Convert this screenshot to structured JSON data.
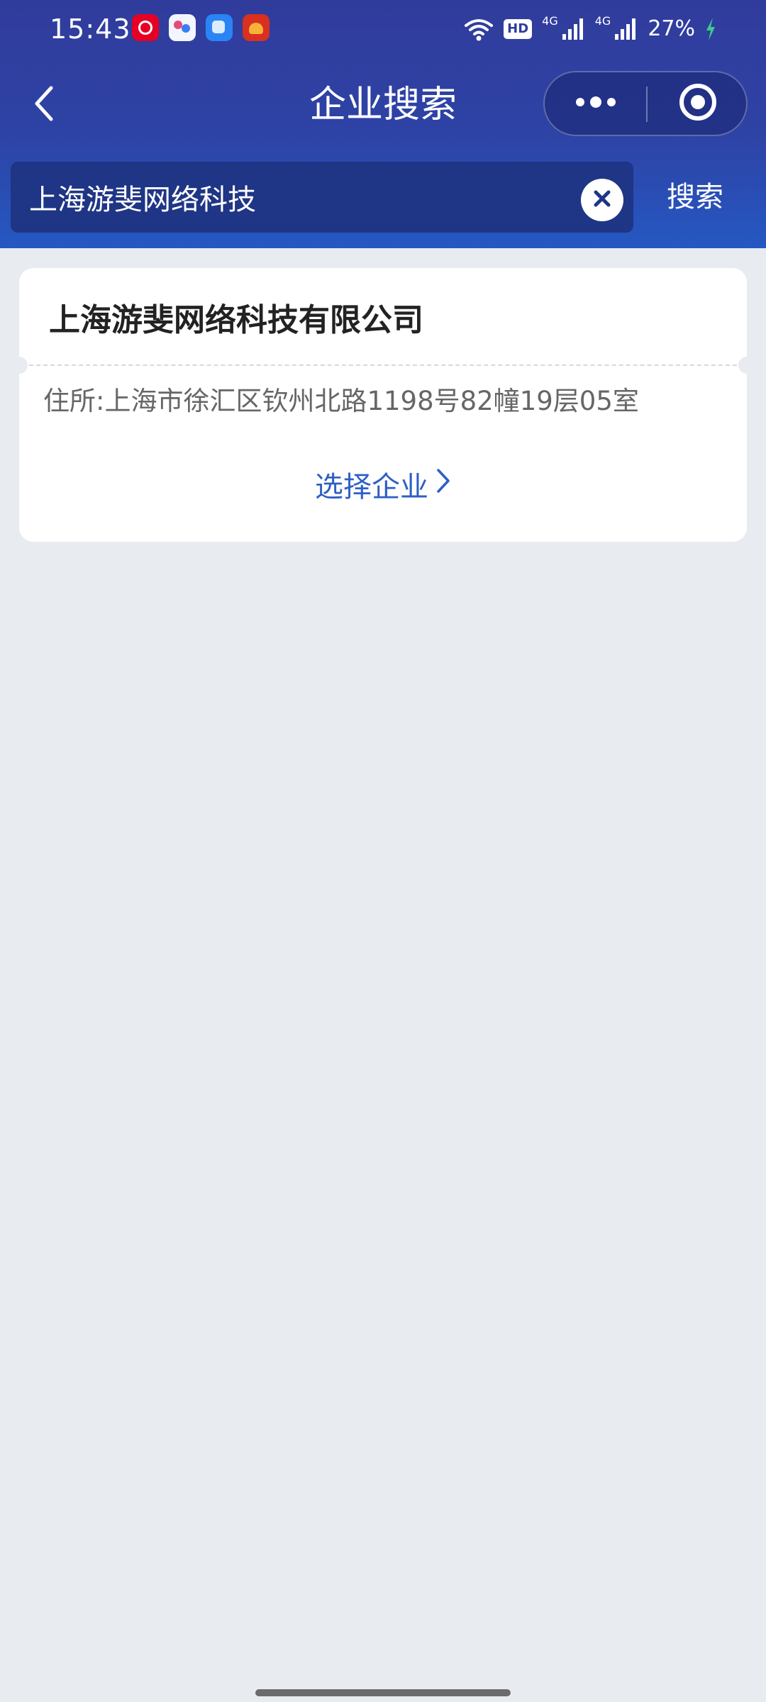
{
  "status_bar": {
    "time": "15:43",
    "hd_label": "HD",
    "network_1": "4G",
    "network_2": "4G",
    "battery": "27%"
  },
  "navbar": {
    "title": "企业搜索"
  },
  "search": {
    "value": "上海游斐网络科技",
    "button_label": "搜索"
  },
  "results": [
    {
      "name": "上海游斐网络科技有限公司",
      "address": "住所:上海市徐汇区钦州北路1198号82幢19层05室",
      "action_label": "选择企业"
    }
  ],
  "colors": {
    "header_top": "#303c9c",
    "header_bottom": "#2558c2",
    "search_box": "#1f3585",
    "link": "#2e5fc4",
    "page_bg": "#e8ebf0"
  }
}
